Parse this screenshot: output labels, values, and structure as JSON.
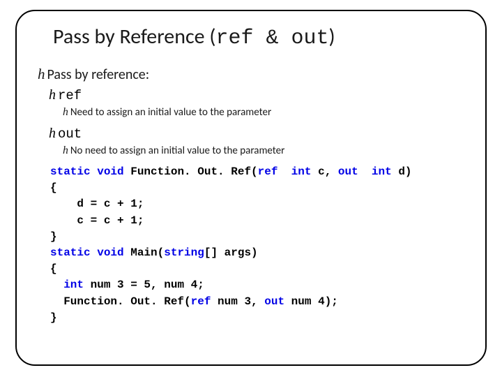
{
  "title": {
    "prefix": "Pass by Reference (",
    "mono": "ref & out",
    "suffix": ")"
  },
  "bullets": {
    "l1": "Pass by reference:",
    "ref": "ref",
    "ref_desc": "Need to assign an initial value to the parameter",
    "out": "out",
    "out_desc": "No need to assign an initial value to the parameter",
    "glyph": "h"
  },
  "code": {
    "l1a": "static",
    "l1b": " ",
    "l1c": "void",
    "l1d": " Function. Out. Ref(",
    "l1e": "ref",
    "l1f": "  ",
    "l1g": "int",
    "l1h": " c, ",
    "l1i": "out",
    "l1j": "  ",
    "l1k": "int",
    "l1l": " d)",
    "l2": "{",
    "l3": "    d = c + 1;",
    "l4": "    c = c + 1;",
    "l5": "}",
    "l6a": "static",
    "l6b": " ",
    "l6c": "void",
    "l6d": " Main(",
    "l6e": "string",
    "l6f": "[] args)",
    "l7": "{",
    "l8a": "  ",
    "l8b": "int",
    "l8c": " num 3 = 5, num 4;",
    "l9a": "  Function. Out. Ref(",
    "l9b": "ref",
    "l9c": " num 3, ",
    "l9d": "out",
    "l9e": " num 4);",
    "l10": "}"
  }
}
